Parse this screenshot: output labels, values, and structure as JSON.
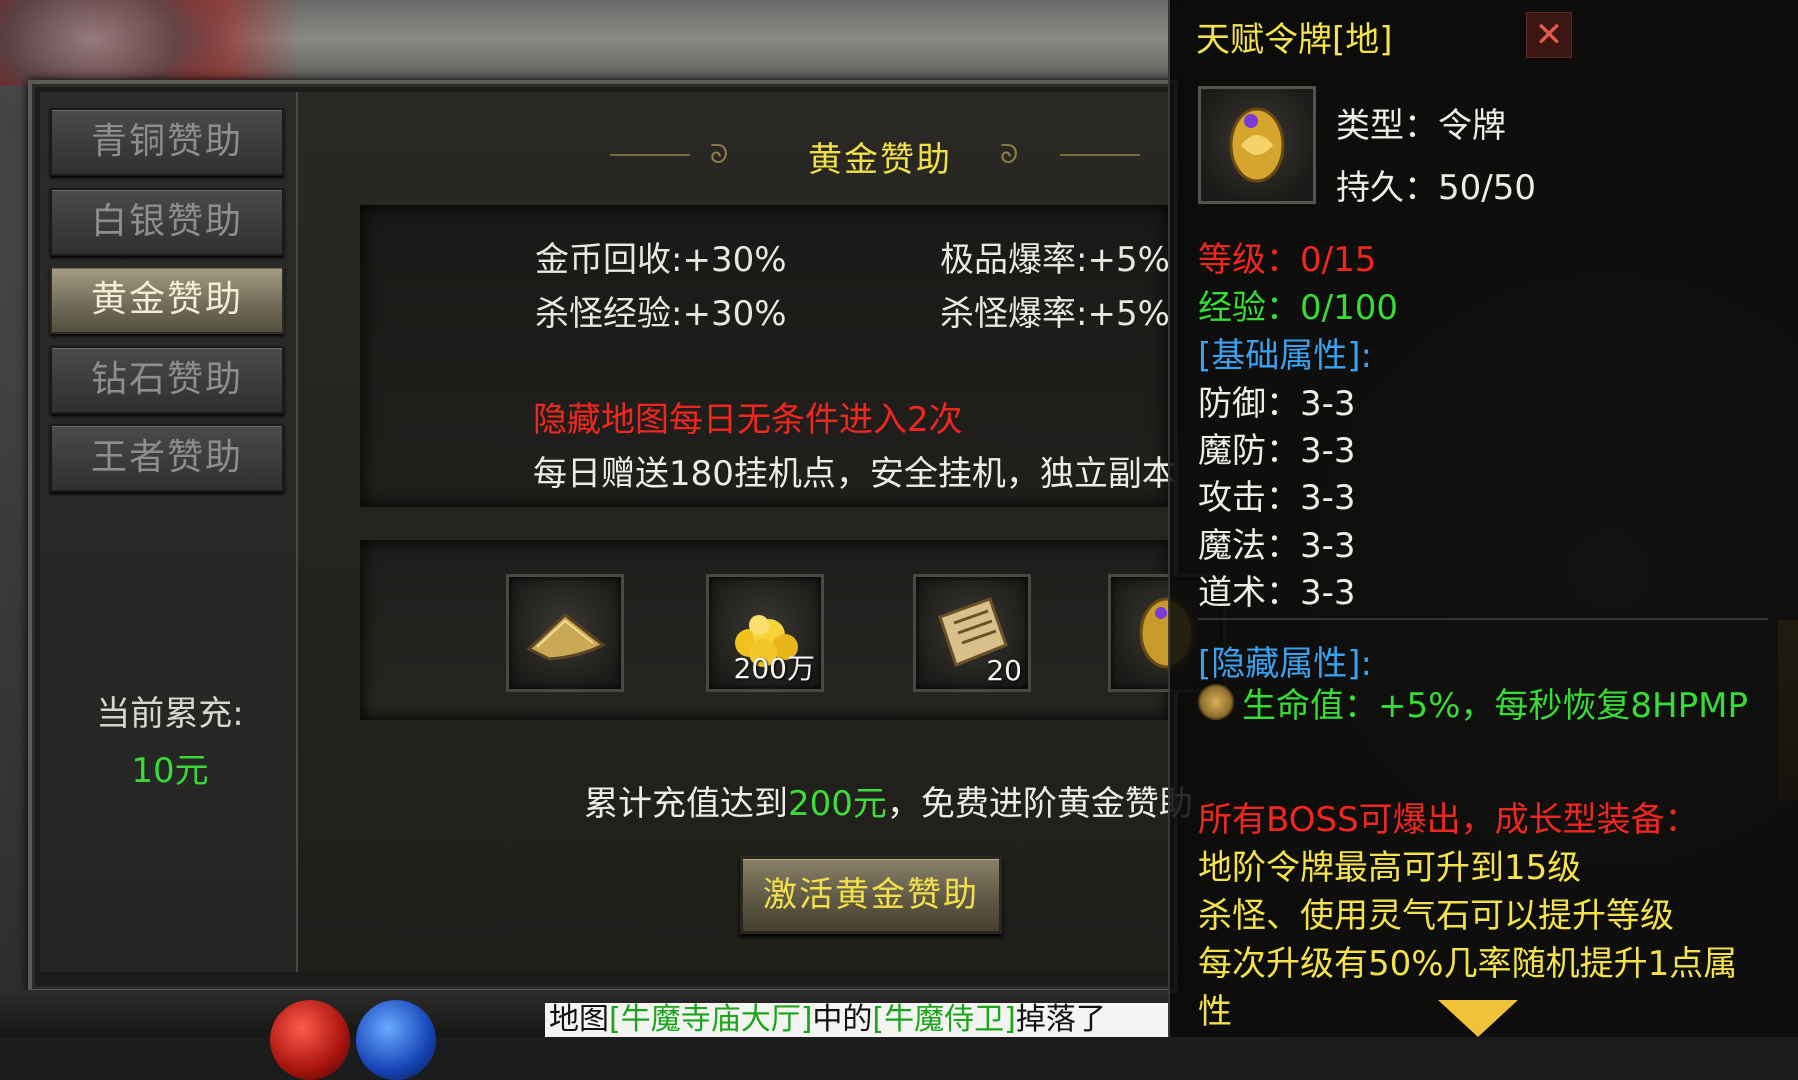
{
  "sidebar": {
    "tabs": [
      {
        "label": "青铜赞助",
        "active": false
      },
      {
        "label": "白银赞助",
        "active": false
      },
      {
        "label": "黄金赞助",
        "active": true
      },
      {
        "label": "钻石赞助",
        "active": false
      },
      {
        "label": "王者赞助",
        "active": false
      }
    ],
    "recharge_label": "当前累充:",
    "recharge_value": "10元"
  },
  "main": {
    "title": "黄金赞助",
    "stats": [
      {
        "label": "金币回收:",
        "value": "+30%"
      },
      {
        "label": "极品爆率:",
        "value": "+5%"
      },
      {
        "label": "杀怪经验:",
        "value": "+30%"
      },
      {
        "label": "杀怪爆率:",
        "value": "+5%"
      }
    ],
    "perk_red": "隐藏地图每日无条件进入2次",
    "perk_white": "每日赠送180挂机点，安全挂机，独立副本",
    "rewards": [
      {
        "name": "hat-icon",
        "count": ""
      },
      {
        "name": "gold-coins-icon",
        "count": "200万"
      },
      {
        "name": "scroll-icon",
        "count": "20"
      },
      {
        "name": "token-icon",
        "count": ""
      }
    ],
    "condition_prefix": "累计充值达到",
    "condition_amount": "200元",
    "condition_suffix": "，免费进阶黄金赞助",
    "activate_label": "激活黄金赞助"
  },
  "chat": {
    "prefix": "地图",
    "map": "[牛魔寺庙大厅]",
    "middle": "中的",
    "monster": "[牛魔侍卫]",
    "suffix": "掉落了"
  },
  "tooltip": {
    "title": "天赋令牌[地]",
    "close_label": "✕",
    "type": "类型：令牌",
    "durability": "持久：50/50",
    "level": "等级：0/15",
    "exp": "经验：0/100",
    "base_header": "[基础属性]:",
    "base_attrs": [
      "防御：3-3",
      "魔防：3-3",
      "攻击：3-3",
      "魔法：3-3",
      "道术：3-3"
    ],
    "hidden_header": "[隐藏属性]:",
    "hidden_attr": "生命值：+5%，每秒恢复8HPMP",
    "drop_note": "所有BOSS可爆出，成长型装备：",
    "desc_lines": [
      "地阶令牌最高可升到15级",
      "杀怪、使用灵气石可以提升等级",
      "每次升级有50%几率随机提升1点属",
      "性"
    ]
  },
  "colors": {
    "gold_text": "#f2e04a",
    "red_text": "#f0261f",
    "green_text": "#37dc37",
    "blue_text": "#3aa0f0"
  }
}
